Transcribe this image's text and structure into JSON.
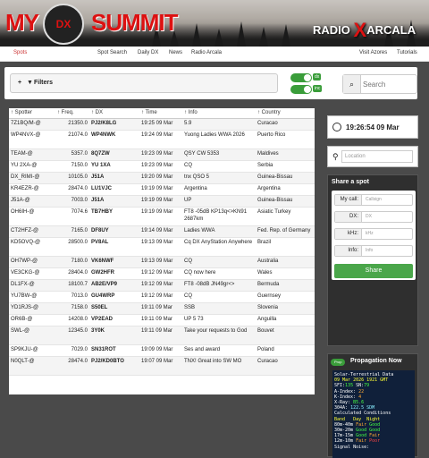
{
  "banner": {
    "my": "MY",
    "dx": "DX",
    "summit": "SUMMIT",
    "radio": "RADIO",
    "x": "X",
    "arcala": "ARCALA"
  },
  "nav": {
    "items": [
      "Spots",
      "Spot Search",
      "Daily DX",
      "News",
      "Radio Arcala"
    ],
    "right": [
      "Visit Azores",
      "Tutorials"
    ]
  },
  "filters": {
    "label": "Filters",
    "toggle_dx": "dx",
    "toggle_inc": "inc",
    "search_placeholder": "Search"
  },
  "table": {
    "headers": [
      "Spotter",
      "Freq.",
      "DX",
      "Time",
      "Info",
      "Country"
    ],
    "rows": [
      [
        "7Z1BQ/M-@",
        "21350.0",
        "PJ2/K8LG",
        "19:25 09 Mar",
        "5.9",
        "Curacao"
      ],
      [
        "WP4NVX-@",
        "21074.0",
        "WP4NWK",
        "19:24 09 Mar",
        "Yuong Ladies WWA 2026",
        "Puerto Rico"
      ],
      [
        "TEAM-@",
        "5357.0",
        "8Q7ZW",
        "19:23 09 Mar",
        "QSY CW 5353",
        "Maldives"
      ],
      [
        "YU 2XA-@",
        "7150.0",
        "YU 1XA",
        "19:23 09 Mar",
        "CQ",
        "Serbia"
      ],
      [
        "DX_RIMI-@",
        "10105.0",
        "J51A",
        "19:20 09 Mar",
        "tnx QSO 5",
        "Guinea-Bissau"
      ],
      [
        "KR4EZR-@",
        "28474.0",
        "LU1VJC",
        "19:19 09 Mar",
        "Argentina",
        "Argentina"
      ],
      [
        "J51A-@",
        "7003.0",
        "J51A",
        "19:19 09 Mar",
        "UP",
        "Guinea-Bissau"
      ],
      [
        "OH6IH-@",
        "7074.6",
        "TB7HBY",
        "19:19 09 Mar",
        "FT8 -05dB KP13q<>KN91 2687km",
        "Asiatic Turkey"
      ],
      [
        "CT2HFZ-@",
        "7165.0",
        "DF8UY",
        "19:14 09 Mar",
        "Ladies WWA",
        "Fed. Rep. of Germany"
      ],
      [
        "KD5OVQ-@",
        "28500.0",
        "PV8AL",
        "19:13 09 Mar",
        "Cq DX AnyStation Anywhere",
        "Brazil"
      ],
      [
        "OH7WP-@",
        "7180.0",
        "VK6NWF",
        "19:13 09 Mar",
        "CQ",
        "Australia"
      ],
      [
        "VE3CKG-@",
        "28404.0",
        "GW2HFR",
        "19:12 09 Mar",
        "CQ now here",
        "Wales"
      ],
      [
        "DL1FX-@",
        "18100.7",
        "AB2E/VP9",
        "19:12 09 Mar",
        "FT8 -08dB JN49gr<>",
        "Bermuda"
      ],
      [
        "YU7BW-@",
        "7013.0",
        "GU4WRP",
        "19:12 09 Mar",
        "CQ",
        "Guernsey"
      ],
      [
        "YD1RJS-@",
        "7158.0",
        "S50EL",
        "19:11 09 Mar",
        "SSB",
        "Slovenia"
      ],
      [
        "OR6B-@",
        "14208.0",
        "VP2EAD",
        "19:11 09 Mar",
        "UP 5 73",
        "Anguilla"
      ],
      [
        "SWL-@",
        "12345.0",
        "3Y0K",
        "19:11 09 Mar",
        "Take your requests to God",
        "Bouvet"
      ],
      [
        "SP9KJU-@",
        "7029.0",
        "SN31ROT",
        "19:09 09 Mar",
        "Ses and award",
        "Poland"
      ],
      [
        "N0QLT-@",
        "28474.0",
        "PJ2/KD0BTO",
        "19:07 09 Mar",
        "TNX! Great into SW MO",
        "Curacao"
      ]
    ]
  },
  "clock": {
    "text": "19:26:54 09 Mar"
  },
  "location": {
    "placeholder": "Location"
  },
  "share": {
    "title": "Share a spot",
    "fields": [
      {
        "label": "My call:",
        "placeholder": "Callsign"
      },
      {
        "label": "DX:",
        "placeholder": "DX"
      },
      {
        "label": "kHz:",
        "placeholder": "kHz"
      },
      {
        "label": "Info:",
        "placeholder": "Info"
      }
    ],
    "button": "Share"
  },
  "propagation": {
    "toggle": "Prop",
    "title": "Propagation Now"
  },
  "solar": {
    "line1": "Solar-Terrestrial Data",
    "line2": "09 Mar 2026 1921 GMT",
    "sfi_label": "SFI:",
    "sfi": "135",
    "sn_label": "SN:",
    "sn": "79",
    "a_label": "A-Index:",
    "a": "22",
    "k_label": "K-Index:",
    "k": "4",
    "xray_label": "X-Ray:",
    "xray": "B5.6",
    "h304_label": "304A:",
    "h304": "122.5",
    "h304_src": "SDM",
    "cc": "Calculated Conditions",
    "cols": [
      "Band",
      "Day",
      "Night"
    ],
    "bands": [
      [
        "80m-40m",
        "Fair",
        "Good"
      ],
      [
        "30m-20m",
        "Good",
        "Good"
      ],
      [
        "17m-15m",
        "Good",
        "Fair"
      ],
      [
        "12m-10m",
        "Fair",
        "Poor"
      ]
    ],
    "sig": "Signal Noise:"
  }
}
